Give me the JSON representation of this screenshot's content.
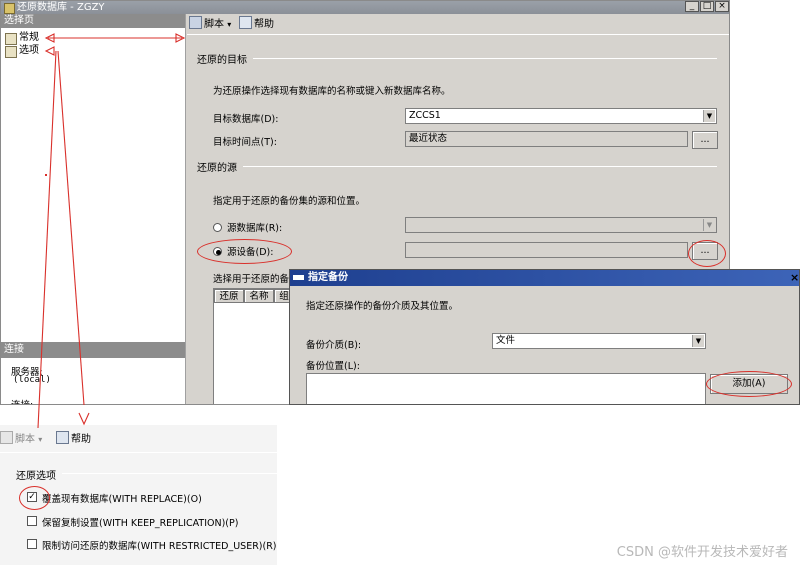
{
  "window": {
    "title": "还原数据库 - ZGZY",
    "controls": {
      "minimize": "_",
      "maximize": "□",
      "close": "×"
    }
  },
  "sidebar": {
    "select_page_header": "选择页",
    "pages": [
      {
        "label": "常规",
        "icon": "page-icon"
      },
      {
        "label": "选项",
        "icon": "page-icon"
      }
    ],
    "connection_header": "连接",
    "server_label": "服务器:",
    "server_value": "(local)",
    "connection_label": "连接:"
  },
  "toolbar": {
    "script_label": "脚本",
    "help_label": "帮助",
    "dropdown_glyph": "▾"
  },
  "restore_target": {
    "section_title": "还原的目标",
    "description": "为还原操作选择现有数据库的名称或键入新数据库名称。",
    "target_db_label": "目标数据库(D):",
    "target_db_value": "ZCCS1",
    "target_time_label": "目标时间点(T):",
    "target_time_value": "最近状态",
    "browse_label": "..."
  },
  "restore_source": {
    "section_title": "还原的源",
    "description": "指定用于还原的备份集的源和位置。",
    "source_db_label": "源数据库(R):",
    "source_device_label": "源设备(D):",
    "browse_label": "...",
    "backup_sets_label": "选择用于还原的备",
    "grid_columns": [
      "还原",
      "名称",
      "组"
    ]
  },
  "dialog": {
    "title": "指定备份",
    "close": "×",
    "description": "指定还原操作的备份介质及其位置。",
    "media_label": "备份介质(B):",
    "media_value": "文件",
    "location_label": "备份位置(L):",
    "add_button": "添加(A)"
  },
  "options_panel": {
    "script_label": "脚本",
    "help_label": "帮助",
    "section_title": "还原选项",
    "options": [
      {
        "label": "覆盖现有数据库(WITH REPLACE)(O)",
        "checked": true
      },
      {
        "label": "保留复制设置(WITH KEEP_REPLICATION)(P)",
        "checked": false
      },
      {
        "label": "限制访问还原的数据库(WITH RESTRICTED_USER)(R)",
        "checked": false
      }
    ]
  },
  "watermark": "CSDN @软件开发技术爱好者",
  "colors": {
    "annotation": "#d9302b",
    "dialog_title": "#1e3f8f",
    "window_bg": "#d6d3ce"
  }
}
